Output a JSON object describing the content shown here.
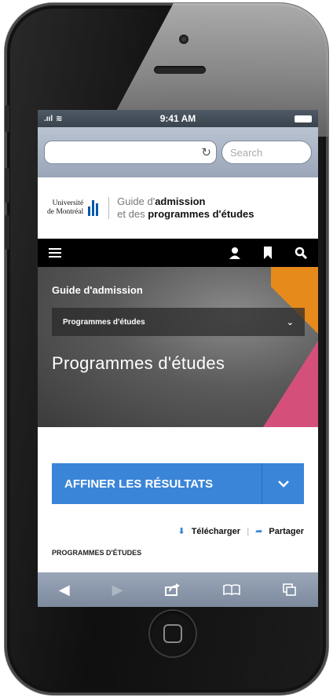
{
  "status_bar": {
    "signal": ".ııl",
    "wifi": "≋",
    "time": "9:41 AM"
  },
  "browser": {
    "url_value": "",
    "search_placeholder": "Search"
  },
  "site": {
    "logo_line1": "Université",
    "logo_line2": "de Montréal",
    "guide_line1_prefix": "Guide d'",
    "guide_line1_bold": "admission",
    "guide_line2_prefix": "et des ",
    "guide_line2_bold": "programmes d'études"
  },
  "hero": {
    "breadcrumb": "Guide d'admission",
    "select_value": "Programmes d'études",
    "title": "Programmes d'études"
  },
  "content": {
    "refine_button": "AFFINER LES RÉSULTATS",
    "download_label": "Télécharger",
    "share_label": "Partager",
    "section_heading": "PROGRAMMES D'ÉTUDES"
  },
  "colors": {
    "accent": "#3a85d8",
    "orange": "#e58a1b",
    "pink": "#d4507a"
  }
}
